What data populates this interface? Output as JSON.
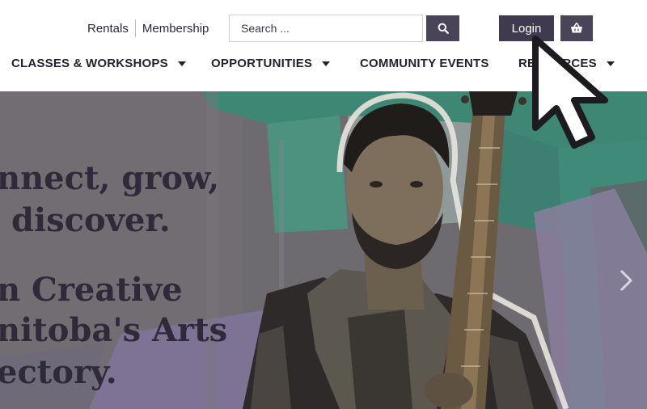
{
  "top_links": {
    "rentals": "Rentals",
    "membership": "Membership"
  },
  "search": {
    "placeholder": "Search ..."
  },
  "header": {
    "login_label": "Login"
  },
  "nav": {
    "items": [
      {
        "label": "CLASSES & WORKSHOPS",
        "has_dropdown": true
      },
      {
        "label": "OPPORTUNITIES",
        "has_dropdown": true
      },
      {
        "label": "COMMUNITY EVENTS",
        "has_dropdown": false
      },
      {
        "label": "RESOURCES",
        "has_dropdown": true
      }
    ]
  },
  "hero": {
    "line1": "nnect, grow,",
    "line2": "discover.",
    "line3": "n Creative",
    "line4": "nitoba's Arts",
    "line5": "ectory."
  },
  "icons": {
    "search": "search-icon",
    "cart": "shopping-basket-icon",
    "next": "chevron-right-icon",
    "cursor": "mouse-pointer-icon",
    "dropdown": "caret-down-icon"
  },
  "colors": {
    "button_dark": "#3f3a4e",
    "button_medium": "#4a4458",
    "nav_text": "#24212e",
    "hero_text": "#2e2a3a",
    "hero_teal": "#3f8e7d",
    "hero_purple": "#8a7e9e"
  }
}
